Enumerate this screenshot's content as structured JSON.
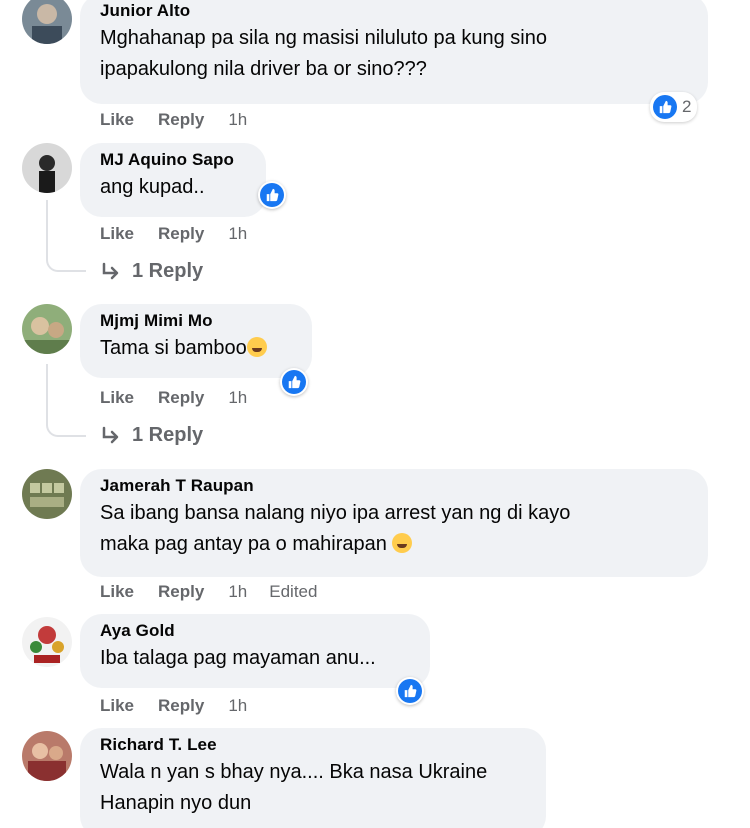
{
  "comments": [
    {
      "author": "Junior Alto",
      "text_lines": [
        "Mghahanap pa sila ng masisi niluluto pa kung sino",
        "ipapakulong nila driver ba or sino???"
      ],
      "like": "Like",
      "reply": "Reply",
      "time": "1h",
      "reaction_count": "2"
    },
    {
      "author": "MJ Aquino Sapo",
      "text_lines": [
        "ang kupad.."
      ],
      "like": "Like",
      "reply": "Reply",
      "time": "1h",
      "replies_label": "1 Reply"
    },
    {
      "author": "Mjmj Mimi Mo",
      "text_lines": [
        "Tama si bamboo"
      ],
      "like": "Like",
      "reply": "Reply",
      "time": "1h",
      "replies_label": "1 Reply"
    },
    {
      "author": "Jamerah T Raupan",
      "text_lines": [
        "Sa ibang bansa nalang niyo ipa arrest yan ng di kayo",
        "maka pag antay pa o mahirapan"
      ],
      "like": "Like",
      "reply": "Reply",
      "time": "1h",
      "edited": "Edited"
    },
    {
      "author": "Aya Gold",
      "text_lines": [
        "Iba talaga pag mayaman anu..."
      ],
      "like": "Like",
      "reply": "Reply",
      "time": "1h"
    },
    {
      "author": "Richard T. Lee",
      "text_lines": [
        "Wala n yan s bhay nya.... Bka nasa Ukraine",
        "Hanapin nyo dun"
      ]
    }
  ],
  "colors": {
    "bubble": "#f0f2f5",
    "meta": "#65676b",
    "like_blue": "#1877f2"
  },
  "icons": {
    "like_badge": "thumbs-up-icon",
    "reply_arrow": "reply-arrow-icon",
    "emoji": "laughing-emoji-icon"
  }
}
